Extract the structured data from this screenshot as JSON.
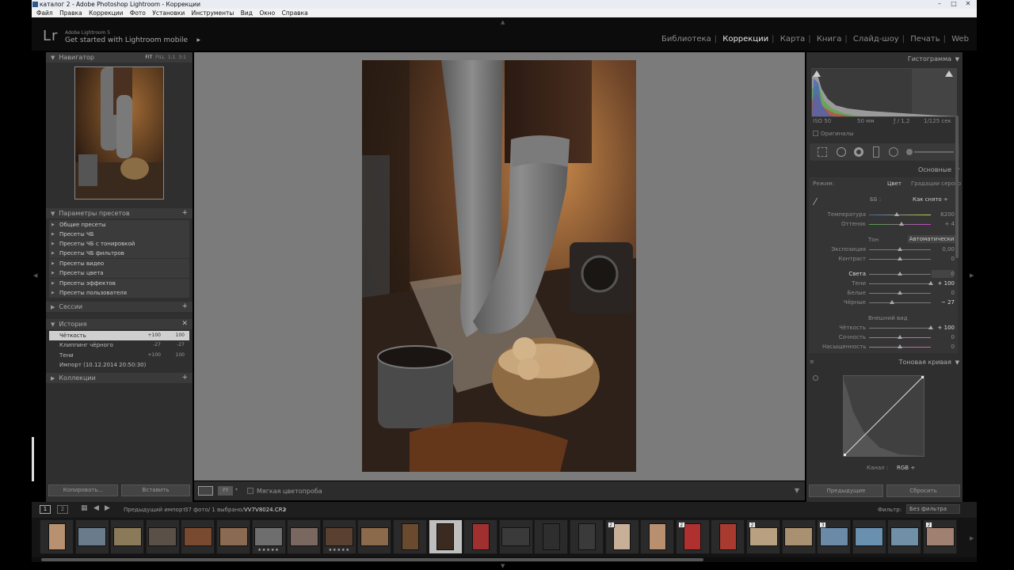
{
  "window": {
    "title": "каталог 2 - Adobe Photoshop Lightroom - Коррекции",
    "min": "–",
    "max": "□",
    "close": "✕"
  },
  "menu": [
    "Файл",
    "Правка",
    "Коррекции",
    "Фото",
    "Установки",
    "Инструменты",
    "Вид",
    "Окно",
    "Справка"
  ],
  "identity": {
    "logo": "Lr",
    "product": "Adobe Lightroom 5",
    "mobile": "Get started with Lightroom mobile",
    "arrow": "▸"
  },
  "modules": [
    "Библиотека",
    "Коррекции",
    "Карта",
    "Книга",
    "Слайд-шоу",
    "Печать",
    "Web"
  ],
  "active_module": "Коррекции",
  "navigator": {
    "title": "Навигатор",
    "opts": [
      "FIT",
      "FILL",
      "1:1",
      "3:1"
    ]
  },
  "presets": {
    "title": "Параметры пресетов",
    "plus": "+",
    "items": [
      "Общие пресеты",
      "Пресеты ЧБ",
      "Пресеты ЧБ с тонировкой",
      "Пресеты ЧБ фильтров",
      "Пресеты видео",
      "Пресеты цвета",
      "Пресеты эффектов",
      "Пресеты пользователя"
    ]
  },
  "sessions": {
    "title": "Сессии",
    "plus": "+"
  },
  "history": {
    "title": "История",
    "close": "✕",
    "items": [
      {
        "label": "Чёткость",
        "v1": "+100",
        "v2": "100"
      },
      {
        "label": "Клиппинг чёрного",
        "v1": "-27",
        "v2": "-27"
      },
      {
        "label": "Тени",
        "v1": "+100",
        "v2": "100"
      },
      {
        "label": "Импорт (10.12.2014 20:50:30)",
        "v1": "",
        "v2": ""
      }
    ]
  },
  "collections": {
    "title": "Коллекции",
    "plus": "+"
  },
  "left_buttons": {
    "copy": "Копировать...",
    "paste": "Вставить"
  },
  "toolbar": {
    "soft_proof": "Мягкая цветопроба"
  },
  "histogram": {
    "title": "Гистограмма",
    "iso": "ISO 50",
    "focal": "50 мм",
    "aperture": "ƒ / 1,2",
    "shutter": "1/125 сек",
    "originals": "Оригиналы"
  },
  "basic": {
    "title": "Основные",
    "mode_label": "Режим:",
    "mode_color": "Цвет",
    "mode_gray": "Градации серого",
    "wb_label": "ББ :",
    "wb_value": "Как снято ÷",
    "temp": {
      "label": "Температура",
      "value": "6200"
    },
    "tint": {
      "label": "Оттенок",
      "value": "+ 4"
    },
    "tone_label": "Тон",
    "auto": "Автоматически",
    "exposure": {
      "label": "Экспозиция",
      "value": "0,00"
    },
    "contrast": {
      "label": "Контраст",
      "value": "0"
    },
    "highlights": {
      "label": "Света",
      "value": "0"
    },
    "shadows": {
      "label": "Тени",
      "value": "+ 100"
    },
    "whites": {
      "label": "Белые",
      "value": "0"
    },
    "blacks": {
      "label": "Чёрные",
      "value": "− 27"
    },
    "presence_label": "Внешний вид",
    "clarity": {
      "label": "Чёткость",
      "value": "+ 100"
    },
    "vibrance": {
      "label": "Сочность",
      "value": "0"
    },
    "saturation": {
      "label": "Насыщенность",
      "value": "0"
    }
  },
  "slider_levels": {
    "temp": 0.45,
    "tint": 0.52,
    "exposure": 0.5,
    "contrast": 0.5,
    "highlights": 0.5,
    "shadows": 1.0,
    "whites": 0.5,
    "blacks": 0.37,
    "clarity": 1.0,
    "vibrance": 0.5,
    "saturation": 0.5
  },
  "tone_curve": {
    "title": "Тоновая кривая",
    "channel_label": "Канал :",
    "channel_value": "RGB ÷"
  },
  "right_buttons": {
    "previous": "Предыдущие",
    "reset": "Сбросить"
  },
  "filmstrip_bar": {
    "pages": [
      "1",
      "2"
    ],
    "source": "Предыдущий импорт",
    "count": "37 фото/ 1 выбрано/",
    "file": "VV7V8024.CR2",
    "dropdown": "▾",
    "filter_label": "Фильтр:",
    "filter_value": "Без фильтра"
  },
  "thumbs": [
    {
      "badge": "",
      "stars": ""
    },
    {
      "badge": "",
      "stars": ""
    },
    {
      "badge": "",
      "stars": ""
    },
    {
      "badge": "",
      "stars": ""
    },
    {
      "badge": "",
      "stars": ""
    },
    {
      "badge": "",
      "stars": ""
    },
    {
      "badge": "",
      "stars": "★★★★★"
    },
    {
      "badge": "",
      "stars": ""
    },
    {
      "badge": "",
      "stars": "★★★★★"
    },
    {
      "badge": "",
      "stars": ""
    },
    {
      "badge": "",
      "stars": ""
    },
    {
      "badge": "",
      "stars": ""
    },
    {
      "badge": "",
      "stars": ""
    },
    {
      "badge": "",
      "stars": ""
    },
    {
      "badge": "",
      "stars": ""
    },
    {
      "badge": "",
      "stars": ""
    },
    {
      "badge": "2",
      "stars": ""
    },
    {
      "badge": "",
      "stars": ""
    },
    {
      "badge": "2",
      "stars": ""
    },
    {
      "badge": "",
      "stars": ""
    },
    {
      "badge": "2",
      "stars": ""
    },
    {
      "badge": "",
      "stars": ""
    },
    {
      "badge": "3",
      "stars": ""
    },
    {
      "badge": "",
      "stars": ""
    },
    {
      "badge": "",
      "stars": ""
    },
    {
      "badge": "2",
      "stars": ""
    }
  ]
}
